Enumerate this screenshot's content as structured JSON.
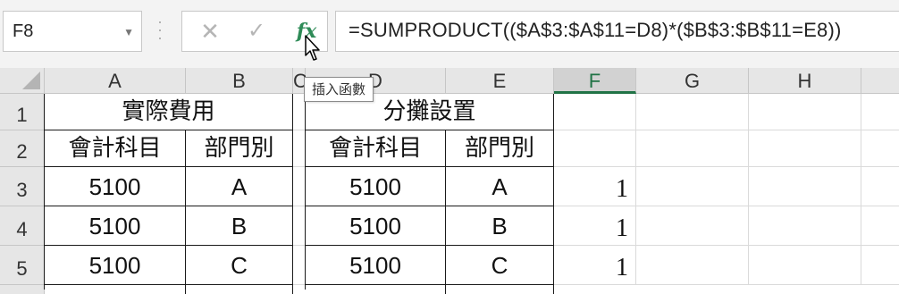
{
  "name_box": {
    "value": "F8"
  },
  "formula_bar": {
    "cancel_symbol": "✕",
    "enter_symbol": "✓",
    "fx_label": "fx",
    "formula": "=SUMPRODUCT(($A$3:$A$11=D8)*($B$3:$B$11=E8))"
  },
  "tooltip": {
    "text": "插入函數"
  },
  "columns": [
    "A",
    "B",
    "C",
    "D",
    "E",
    "F",
    "G",
    "H"
  ],
  "selected_column": "F",
  "rows": [
    "1",
    "2",
    "3",
    "4",
    "5"
  ],
  "cells": {
    "A1": "實際費用",
    "D1": "分攤設置",
    "A2": "會計科目",
    "B2": "部門別",
    "D2": "會計科目",
    "E2": "部門別",
    "A3": "5100",
    "B3": "A",
    "D3": "5100",
    "E3": "A",
    "F3": "1",
    "A4": "5100",
    "B4": "B",
    "D4": "5100",
    "E4": "B",
    "F4": "1",
    "A5": "5100",
    "B5": "C",
    "D5": "5100",
    "E5": "C",
    "F5": "1"
  },
  "colors": {
    "accent": "#217346",
    "header_bg": "#e6e6e6",
    "selected_header_bg": "#d2d2d2"
  }
}
